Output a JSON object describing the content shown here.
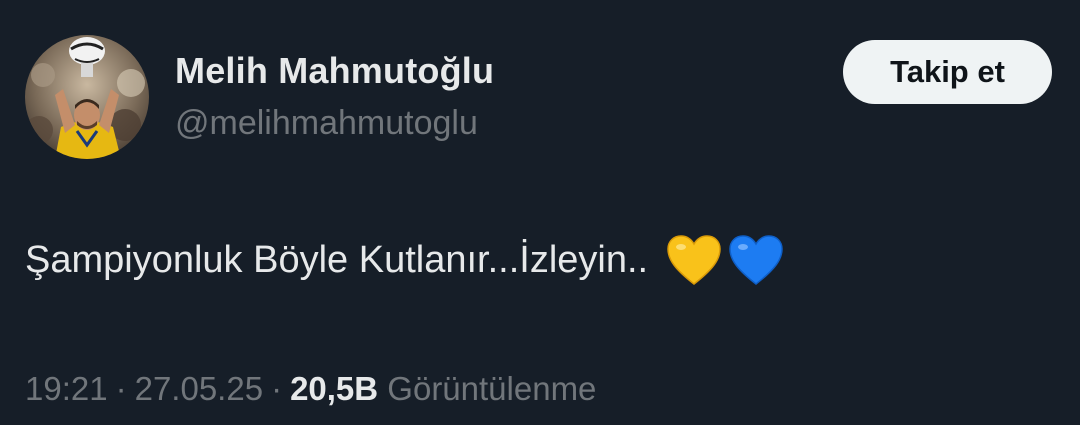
{
  "author": {
    "display_name": "Melih Mahmutoğlu",
    "handle": "@melihmahmutoglu",
    "avatar_icon": "profile-photo"
  },
  "follow_button": {
    "label": "Takip et"
  },
  "tweet": {
    "text": "Şampiyonluk Böyle Kutlanır...İzleyin..",
    "emojis": [
      "yellow-heart-icon",
      "blue-heart-icon"
    ]
  },
  "meta": {
    "time": "19:21",
    "separator": "·",
    "date": "27.05.25",
    "views_count": "20,5B",
    "views_label": "Görüntülenme"
  },
  "colors": {
    "background": "#161e28",
    "primary_text": "#e7e9ea",
    "secondary_text": "#71767b",
    "button_bg": "#eff3f4",
    "yellow_heart": "#f9c21a",
    "blue_heart": "#1d7cf2"
  }
}
